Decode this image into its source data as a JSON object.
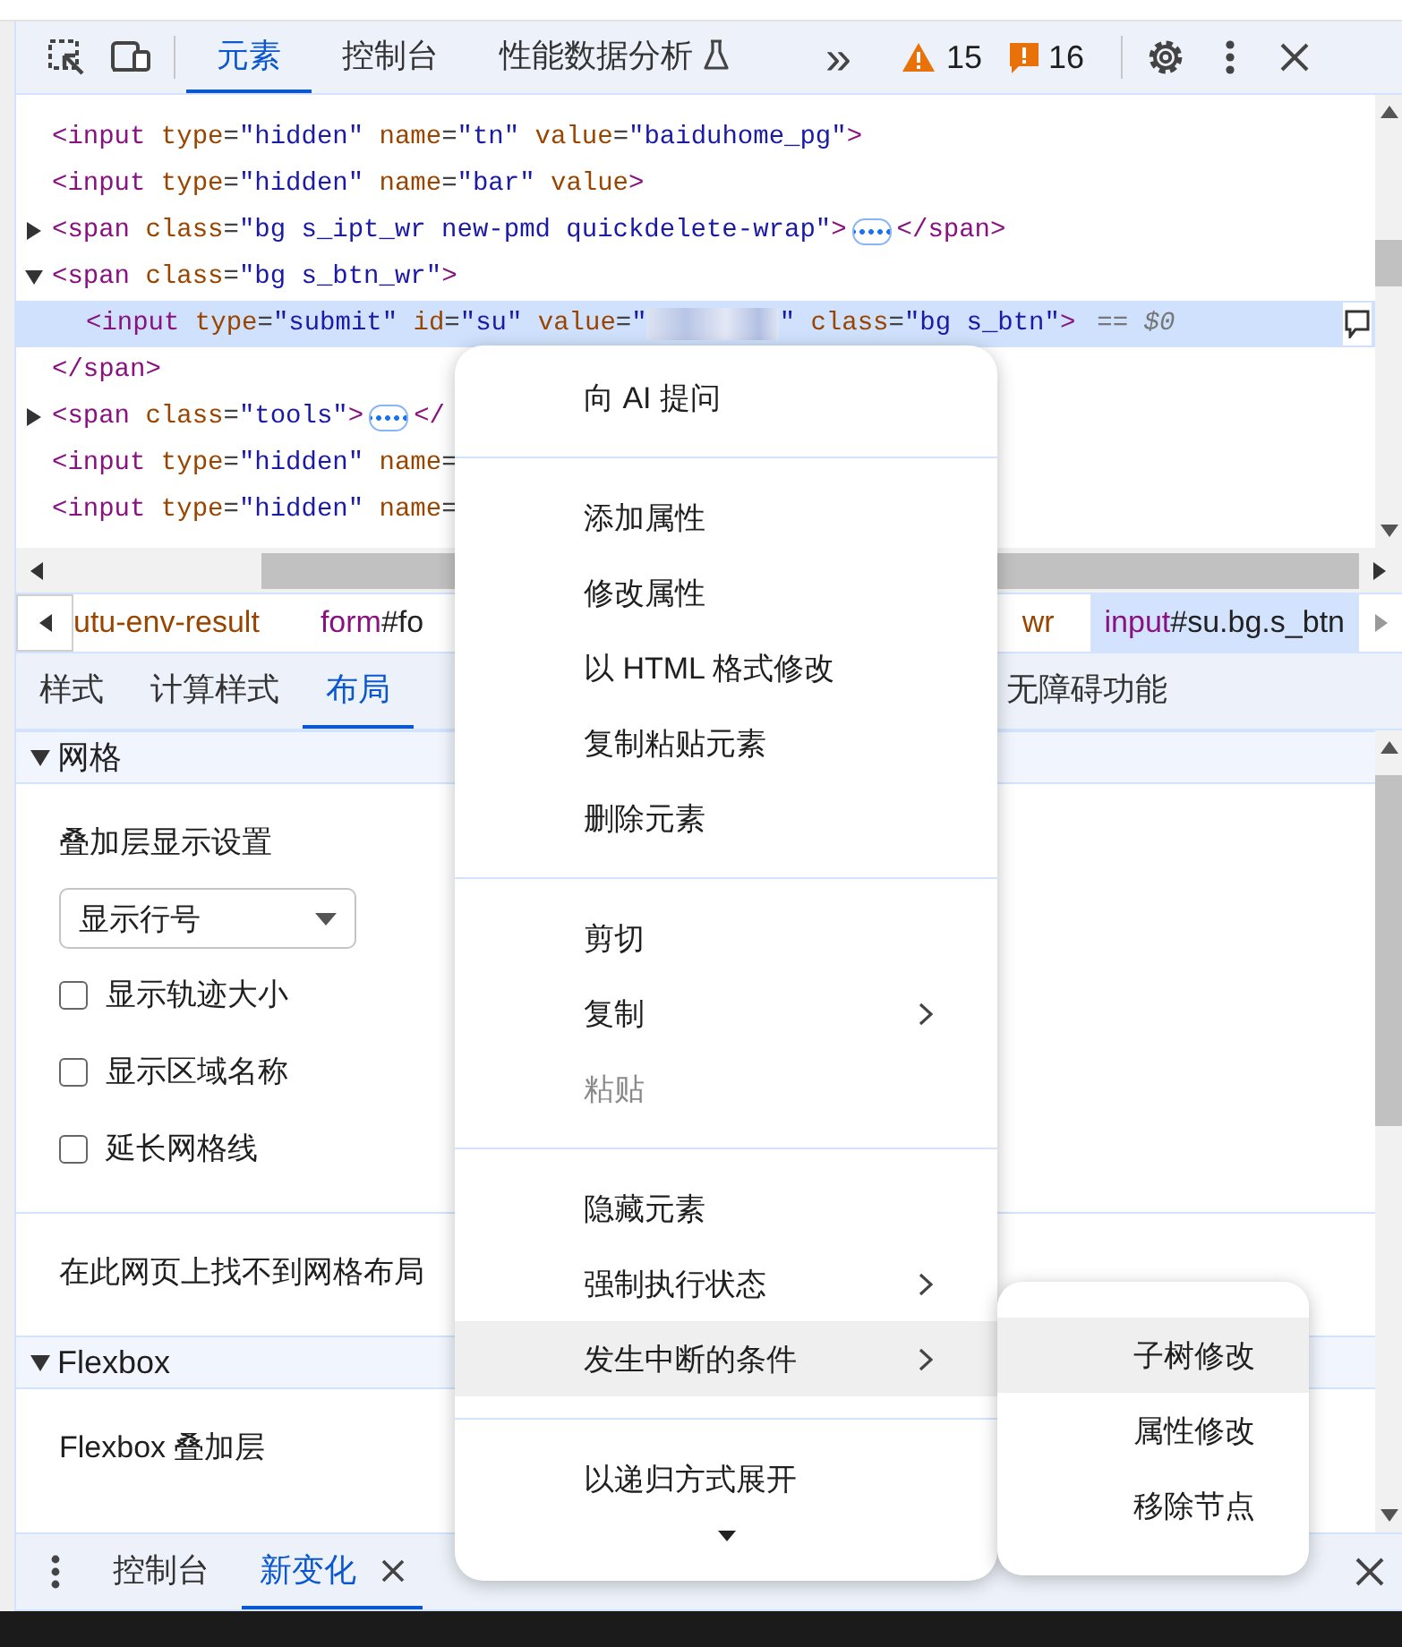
{
  "toolbar": {
    "tabs": [
      {
        "label": "元素",
        "selected": true,
        "experimental": false
      },
      {
        "label": "控制台",
        "selected": false,
        "experimental": false
      },
      {
        "label": "性能数据分析",
        "selected": false,
        "experimental": true
      }
    ],
    "overflow": "»",
    "warnings": "15",
    "issues": "16"
  },
  "elements_panel": {
    "nodes": [
      {
        "text": "<input type=\"hidden\" name=\"tn\" value=\"baiduhome_pg\">",
        "selected": false
      },
      {
        "text": "<input type=\"hidden\" name=\"bar\" value>",
        "selected": false
      },
      {
        "text": "<span class=\"bg s_ipt_wr new-pmd quickdelete-wrap\">",
        "expanded": false,
        "close": "</span>",
        "selected": false
      },
      {
        "text": "<span class=\"bg s_btn_wr\">",
        "expanded": true,
        "close": "</span>",
        "selected": false,
        "children": [
          {
            "text": "<input type=\"submit\" id=\"su\" value=\"",
            "blurred": true,
            "text_after": "\" class=\"bg s_btn\">",
            "marker": "== $0",
            "selected": true
          }
        ]
      },
      {
        "text": "<span class=\"tools\">",
        "expanded": false,
        "close": "</",
        "selected": false
      },
      {
        "text": "<input type=\"hidden\" name=",
        "selected": false
      },
      {
        "text": "<input type=\"hidden\" name=",
        "selected": false
      }
    ]
  },
  "breadcrumbs": [
    {
      "text": "utu-env-result",
      "selected": false
    },
    {
      "text": "form#fo",
      "selected": false
    },
    {
      "text": "wr",
      "selected": false
    },
    {
      "text": "input#su.bg.s_btn",
      "selected": true
    }
  ],
  "sub_tabs": [
    {
      "label": "样式",
      "selected": false
    },
    {
      "label": "计算样式",
      "selected": false
    },
    {
      "label": "布局",
      "selected": true
    },
    {
      "label": "无障碍功能",
      "selected": false
    }
  ],
  "layout_pane": {
    "sections": [
      {
        "title": "网格",
        "expanded": true,
        "overlay_title": "叠加层显示设置",
        "dropdown": "显示行号",
        "checkboxes": [
          {
            "label": "显示轨迹大小",
            "checked": false
          },
          {
            "label": "显示区域名称",
            "checked": false
          },
          {
            "label": "延长网格线",
            "checked": false
          }
        ],
        "message": "在此网页上找不到网格布局"
      },
      {
        "title": "Flexbox",
        "expanded": true,
        "overlay_title": "Flexbox 叠加层"
      }
    ]
  },
  "drawer": {
    "tabs": [
      {
        "label": "控制台",
        "selected": false,
        "closable": false
      },
      {
        "label": "新变化",
        "selected": true,
        "closable": true
      }
    ]
  },
  "context_menu": {
    "groups": [
      [
        {
          "label": "向 AI 提问",
          "submenu": false,
          "disabled": false,
          "selected": false
        }
      ],
      [
        {
          "label": "添加属性",
          "submenu": false,
          "disabled": false,
          "selected": false
        },
        {
          "label": "修改属性",
          "submenu": false,
          "disabled": false,
          "selected": false
        },
        {
          "label": "以 HTML 格式修改",
          "submenu": false,
          "disabled": false,
          "selected": false
        },
        {
          "label": "复制粘贴元素",
          "submenu": false,
          "disabled": false,
          "selected": false
        },
        {
          "label": "删除元素",
          "submenu": false,
          "disabled": false,
          "selected": false
        }
      ],
      [
        {
          "label": "剪切",
          "submenu": false,
          "disabled": false,
          "selected": false
        },
        {
          "label": "复制",
          "submenu": true,
          "disabled": false,
          "selected": false
        },
        {
          "label": "粘贴",
          "submenu": false,
          "disabled": true,
          "selected": false
        }
      ],
      [
        {
          "label": "隐藏元素",
          "submenu": false,
          "disabled": false,
          "selected": false
        },
        {
          "label": "强制执行状态",
          "submenu": true,
          "disabled": false,
          "selected": false
        },
        {
          "label": "发生中断的条件",
          "submenu": true,
          "disabled": false,
          "selected": true,
          "children": [
            {
              "label": "子树修改",
              "selected": true
            },
            {
              "label": "属性修改",
              "selected": false
            },
            {
              "label": "移除节点",
              "selected": false
            }
          ]
        }
      ],
      [
        {
          "label": "以递归方式展开",
          "submenu": false,
          "disabled": false,
          "selected": false
        }
      ]
    ]
  }
}
